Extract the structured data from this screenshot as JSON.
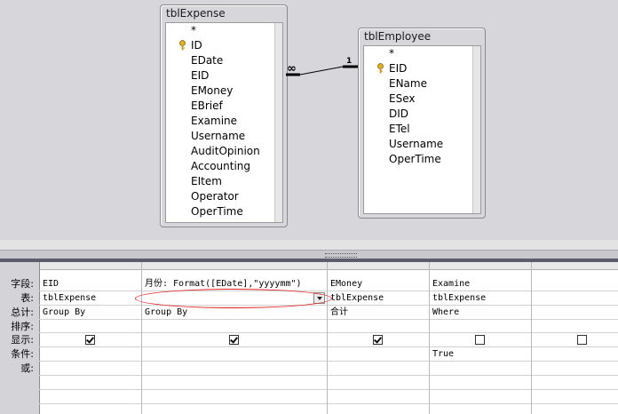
{
  "relationships": {
    "tables": [
      {
        "name": "tblExpense",
        "fields": [
          "*",
          "ID",
          "EDate",
          "EID",
          "EMoney",
          "EBrief",
          "Examine",
          "Username",
          "AuditOpinion",
          "Accounting",
          "EItem",
          "Operator",
          "OperTime"
        ],
        "key_field": "ID"
      },
      {
        "name": "tblEmployee",
        "fields": [
          "*",
          "EID",
          "EName",
          "ESex",
          "DID",
          "ETel",
          "Username",
          "OperTime"
        ],
        "key_field": "EID"
      }
    ],
    "join": {
      "many_symbol": "∞",
      "one_symbol": "1"
    }
  },
  "grid": {
    "row_labels": [
      "字段:",
      "表:",
      "总计:",
      "排序:",
      "显示:",
      "条件:",
      "或:"
    ],
    "columns": [
      {
        "field": "EID",
        "table": "tblExpense",
        "total": "Group By",
        "sort": "",
        "show": true,
        "criteria": "",
        "or": ""
      },
      {
        "field": "月份: Format([EDate],\"yyyymm\")",
        "table": "",
        "total": "Group By",
        "sort": "",
        "show": true,
        "criteria": "",
        "or": ""
      },
      {
        "field": "EMoney",
        "table": "tblExpense",
        "total": "合计",
        "sort": "",
        "show": true,
        "criteria": "",
        "or": ""
      },
      {
        "field": "Examine",
        "table": "tblExpense",
        "total": "Where",
        "sort": "",
        "show": false,
        "criteria": "True",
        "or": ""
      },
      {
        "field": "",
        "table": "",
        "total": "",
        "sort": "",
        "show": false,
        "criteria": "",
        "or": ""
      }
    ]
  },
  "annotation": {
    "color": "#e02020"
  }
}
